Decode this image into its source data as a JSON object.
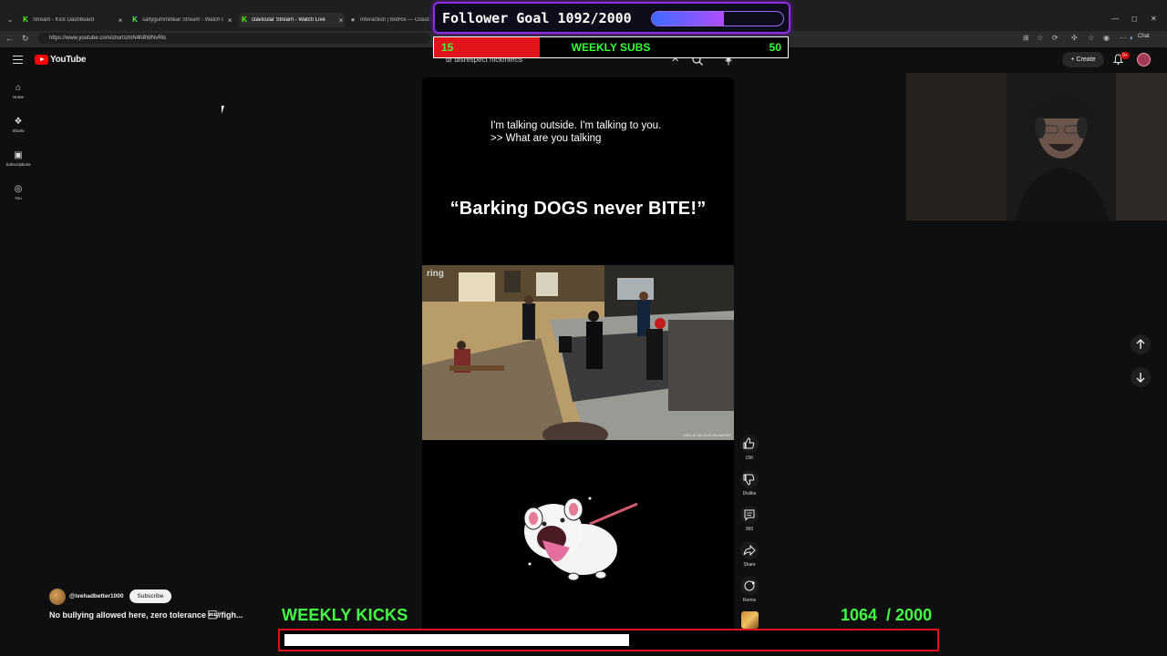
{
  "browser": {
    "tabs": [
      {
        "title": "Stream - Kick Dashboard",
        "icon": "kick-logo-icon",
        "active": false
      },
      {
        "title": "saltygummibear Stream - Watch Li",
        "icon": "kick-logo-icon",
        "active": false
      },
      {
        "title": "clavicular Stream - Watch Live",
        "icon": "kick-logo-icon",
        "active": true
      },
      {
        "title": "Interaction | BotRix — Cloud S",
        "icon": "botrix-icon",
        "active": false
      }
    ],
    "url": "https://www.youtube.com/shorts/mN4hBWNvRls",
    "chat_label": "Chat"
  },
  "youtube": {
    "logo_text": "YouTube",
    "sidebar": [
      {
        "label": "Home",
        "icon": "home-icon"
      },
      {
        "label": "Shorts",
        "icon": "shorts-icon"
      },
      {
        "label": "Subscriptions",
        "icon": "subscriptions-icon"
      },
      {
        "label": "You",
        "icon": "user-icon"
      }
    ],
    "search_value": "dr disrespect nickmercs",
    "create_label": "Create",
    "notification_badge": "9+"
  },
  "short": {
    "caption_line1": "I'm talking outside. I'm talking to you.",
    "caption_line2": ">> What are you talking",
    "headline": "“Barking DOGS never BITE!”",
    "cam_logo": "ring",
    "cam_stamp": "2024-11-18 10:21:44 AM EST",
    "actions": {
      "like_count": "15K",
      "dislike_label": "Dislike",
      "comment_count": "950",
      "share_label": "Share",
      "remix_label": "Remix"
    },
    "channel": "@ivehadbetter1000",
    "subscribe_label": "Subscribe",
    "title": "No bullying allowed here, zero tolerance \u0011#figh..."
  },
  "overlays": {
    "follower_goal": {
      "label": "Follower Goal",
      "current": 1092,
      "goal": 2000,
      "text": "1092/2000"
    },
    "weekly_subs": {
      "label": "WEEKLY SUBS",
      "current": "15",
      "goal": "50",
      "current_num": 15,
      "goal_num": 50
    },
    "weekly_kicks": {
      "label": "WEEKLY KICKS",
      "count_text": "1064  / 2000",
      "current": 1064,
      "goal": 2000
    }
  },
  "colors": {
    "youtube_red": "#ff0000",
    "overlay_green": "#40ff40",
    "goal_purple": "#8e2de2",
    "subs_red": "#e0141a"
  }
}
